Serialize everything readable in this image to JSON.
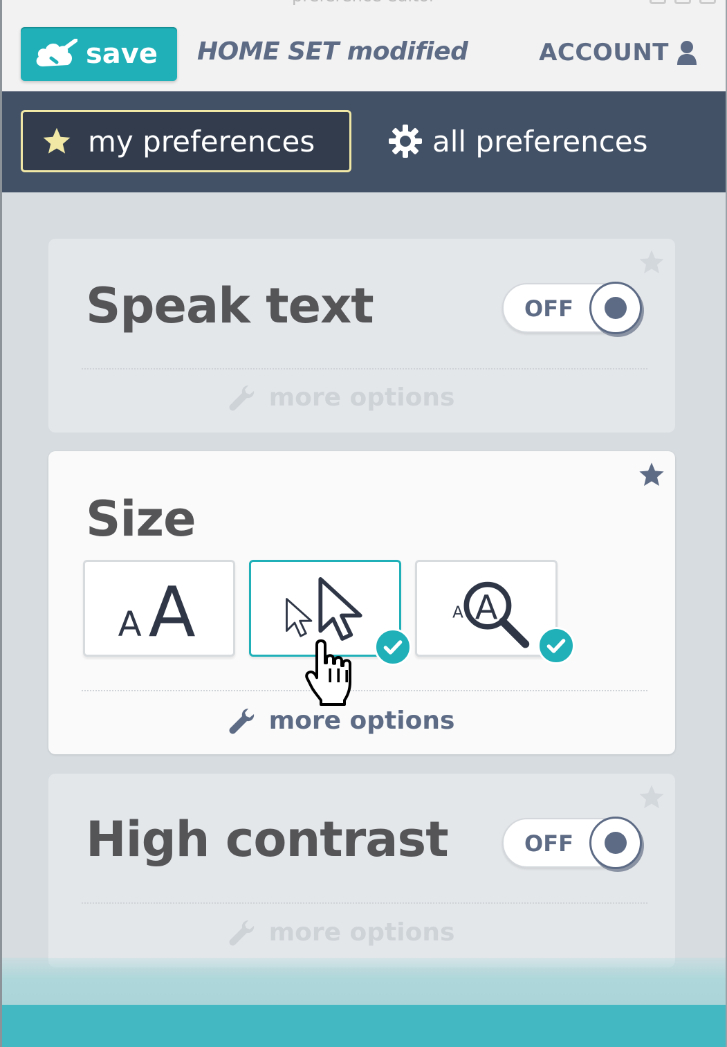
{
  "window": {
    "title": "preference editor"
  },
  "header": {
    "save_label": "save",
    "status_text": "HOME SET modified",
    "account_label": "ACCOUNT"
  },
  "nav": {
    "tabs": [
      {
        "label": "my preferences",
        "icon": "star-icon",
        "active": true
      },
      {
        "label": "all preferences",
        "icon": "gear-icon",
        "active": false
      }
    ]
  },
  "cards": {
    "speak_text": {
      "title": "Speak text",
      "toggle_label": "OFF",
      "more_label": "more options",
      "starred": false
    },
    "size": {
      "title": "Size",
      "more_label": "more options",
      "starred": true,
      "options": [
        {
          "icon": "text-size-icon",
          "small_letter": "A",
          "large_letter": "A",
          "selected": false,
          "checked": false
        },
        {
          "icon": "cursor-size-icon",
          "selected": true,
          "checked": true
        },
        {
          "icon": "magnifier-icon",
          "small_letter": "A",
          "large_letter": "A",
          "selected": false,
          "checked": true
        }
      ]
    },
    "high_contrast": {
      "title": "High contrast",
      "toggle_label": "OFF",
      "more_label": "more options",
      "starred": false
    }
  },
  "colors": {
    "accent": "#1fb0b8",
    "nav_bg": "#435166",
    "text_blue": "#5d6b85",
    "active_tab_border": "#f1e8a6"
  }
}
